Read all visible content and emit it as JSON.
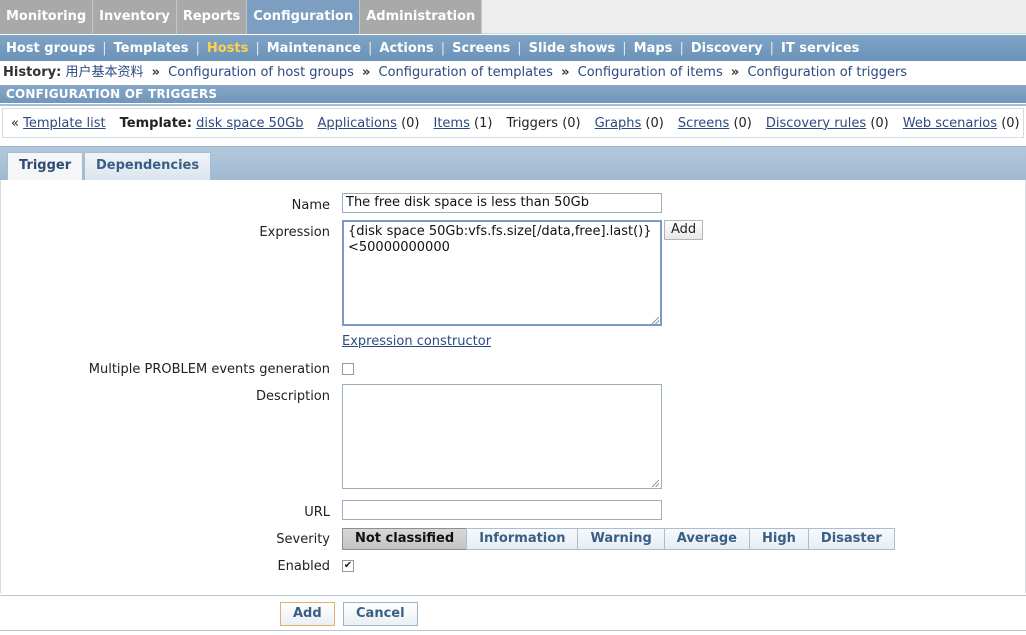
{
  "main_menu": [
    "Monitoring",
    "Inventory",
    "Reports",
    "Configuration",
    "Administration"
  ],
  "main_menu_active": "Configuration",
  "sub_menu": [
    "Host groups",
    "Templates",
    "Hosts",
    "Maintenance",
    "Actions",
    "Screens",
    "Slide shows",
    "Maps",
    "Discovery",
    "IT services"
  ],
  "sub_menu_active": "Hosts",
  "history": {
    "label": "History:",
    "items": [
      "用户基本资料",
      "Configuration of host groups",
      "Configuration of templates",
      "Configuration of items",
      "Configuration of triggers"
    ],
    "separator": "»"
  },
  "section_title": "CONFIGURATION OF TRIGGERS",
  "info_bar": {
    "back_marker": "«",
    "template_list": "Template list",
    "template_label": "Template:",
    "template_name": "disk space 50Gb",
    "applications": "Applications",
    "applications_count": "(0)",
    "items": "Items",
    "items_count": "(1)",
    "triggers": "Triggers",
    "triggers_count": "(0)",
    "graphs": "Graphs",
    "graphs_count": "(0)",
    "screens": "Screens",
    "screens_count": "(0)",
    "discovery_rules": "Discovery rules",
    "discovery_rules_count": "(0)",
    "web_scenarios": "Web scenarios",
    "web_scenarios_count": "(0)"
  },
  "tabs": [
    "Trigger",
    "Dependencies"
  ],
  "active_tab": "Trigger",
  "form": {
    "name_label": "Name",
    "name_value": "The free disk space is less than 50Gb",
    "expression_label": "Expression",
    "expression_value": "{disk space 50Gb:vfs.fs.size[/data,free].last()}\n<50000000000",
    "expression_add_button": "Add",
    "expression_constructor": "Expression constructor",
    "multiple_events_label": "Multiple PROBLEM events generation",
    "multiple_events_checked": false,
    "description_label": "Description",
    "description_value": "",
    "url_label": "URL",
    "url_value": "",
    "severity_label": "Severity",
    "severity_options": [
      "Not classified",
      "Information",
      "Warning",
      "Average",
      "High",
      "Disaster"
    ],
    "severity_selected": "Not classified",
    "enabled_label": "Enabled",
    "enabled_checked": true,
    "enabled_mark": "✔"
  },
  "footer": {
    "add_button": "Add",
    "cancel_button": "Cancel"
  },
  "colors": {
    "accent_blue": "#7c9fc1",
    "active_submenu": "#ffd24a",
    "link": "#2b4a82"
  }
}
